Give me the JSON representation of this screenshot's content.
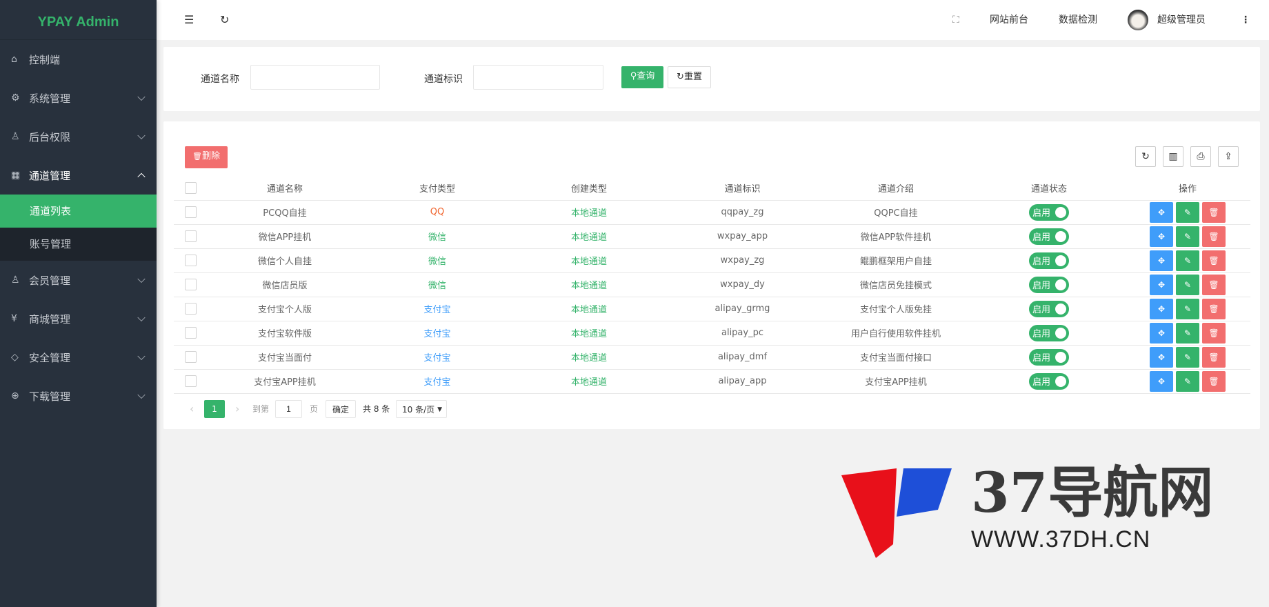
{
  "sidebar": {
    "logo": "YPAY Admin",
    "items": [
      {
        "label": "控制端",
        "icon": "home-icon"
      },
      {
        "label": "系统管理",
        "icon": "gear-icon"
      },
      {
        "label": "后台权限",
        "icon": "user-icon"
      },
      {
        "label": "通道管理",
        "icon": "apps-icon"
      },
      {
        "label": "会员管理",
        "icon": "user-icon"
      },
      {
        "label": "商城管理",
        "icon": "yen-icon"
      },
      {
        "label": "安全管理",
        "icon": "diamond-icon"
      },
      {
        "label": "下载管理",
        "icon": "download-icon"
      }
    ],
    "sub": [
      "通道列表",
      "账号管理"
    ]
  },
  "header": {
    "site_front": "网站前台",
    "data_check": "数据检测",
    "user": "超级管理员"
  },
  "search": {
    "name_label": "通道名称",
    "name_value": "",
    "ident_label": "通道标识",
    "ident_value": "",
    "query": "查询",
    "reset": "重置"
  },
  "toolbar": {
    "delete": "删除"
  },
  "table": {
    "headers": [
      "通道名称",
      "支付类型",
      "创建类型",
      "通道标识",
      "通道介绍",
      "通道状态",
      "操作"
    ],
    "rows": [
      {
        "name": "PCQQ自挂",
        "pay": "QQ",
        "create": "本地通道",
        "ident": "qqpay_zg",
        "intro": "QQPC自挂",
        "status": "启用"
      },
      {
        "name": "微信APP挂机",
        "pay": "微信",
        "create": "本地通道",
        "ident": "wxpay_app",
        "intro": "微信APP软件挂机",
        "status": "启用"
      },
      {
        "name": "微信个人自挂",
        "pay": "微信",
        "create": "本地通道",
        "ident": "wxpay_zg",
        "intro": "鲲鹏框架用户自挂",
        "status": "启用"
      },
      {
        "name": "微信店员版",
        "pay": "微信",
        "create": "本地通道",
        "ident": "wxpay_dy",
        "intro": "微信店员免挂模式",
        "status": "启用"
      },
      {
        "name": "支付宝个人版",
        "pay": "支付宝",
        "create": "本地通道",
        "ident": "alipay_grmg",
        "intro": "支付宝个人版免挂",
        "status": "启用"
      },
      {
        "name": "支付宝软件版",
        "pay": "支付宝",
        "create": "本地通道",
        "ident": "alipay_pc",
        "intro": "用户自行使用软件挂机",
        "status": "启用"
      },
      {
        "name": "支付宝当面付",
        "pay": "支付宝",
        "create": "本地通道",
        "ident": "alipay_dmf",
        "intro": "支付宝当面付接口",
        "status": "启用"
      },
      {
        "name": "支付宝APP挂机",
        "pay": "支付宝",
        "create": "本地通道",
        "ident": "alipay_app",
        "intro": "支付宝APP挂机",
        "status": "启用"
      }
    ]
  },
  "pay_colors": {
    "QQ": "#f0642d",
    "微信": "#35b36b",
    "支付宝": "#3f9dfa"
  },
  "pagination": {
    "current": "1",
    "goto": "到第",
    "goto_value": "1",
    "page": "页",
    "confirm": "确定",
    "total": "共 8 条",
    "per_page": "10 条/页"
  },
  "watermark": {
    "title": "37导航网",
    "url": "WWW.37DH.CN"
  }
}
